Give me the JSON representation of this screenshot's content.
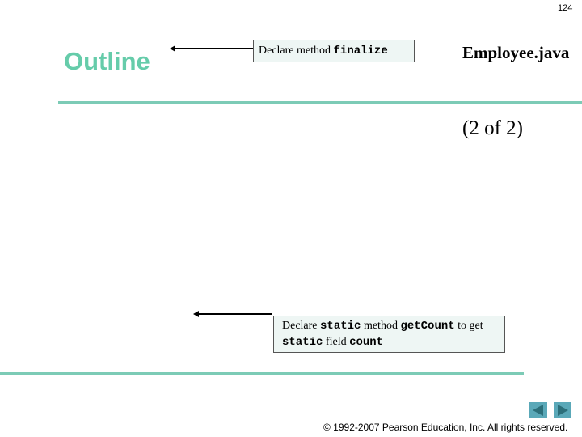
{
  "slide": {
    "page_number": "124",
    "outline_label": "Outline",
    "file_title": "Employee.java",
    "part_label": "(2 of  2)",
    "copyright": "© 1992-2007 Pearson Education, Inc.  All rights reserved."
  },
  "callouts": [
    {
      "segments": [
        {
          "text": "Declare method ",
          "code": false
        },
        {
          "text": "finalize",
          "code": true
        }
      ]
    },
    {
      "segments": [
        {
          "text": "Declare ",
          "code": false
        },
        {
          "text": "static",
          "code": true
        },
        {
          "text": " method ",
          "code": false
        },
        {
          "text": "getCount",
          "code": true
        },
        {
          "text": " to get ",
          "code": false
        },
        {
          "text": "static",
          "code": true
        },
        {
          "text": " field ",
          "code": false
        },
        {
          "text": "count",
          "code": true
        }
      ]
    }
  ],
  "nav": {
    "prev_icon": "triangle-left",
    "next_icon": "triangle-right"
  },
  "colors": {
    "accent": "#66ccaa",
    "rule": "#7ccbb6",
    "nav_button": "#5aa8b8",
    "nav_glyph": "#2c6f7a",
    "callout_bg": "#eef6f4"
  }
}
